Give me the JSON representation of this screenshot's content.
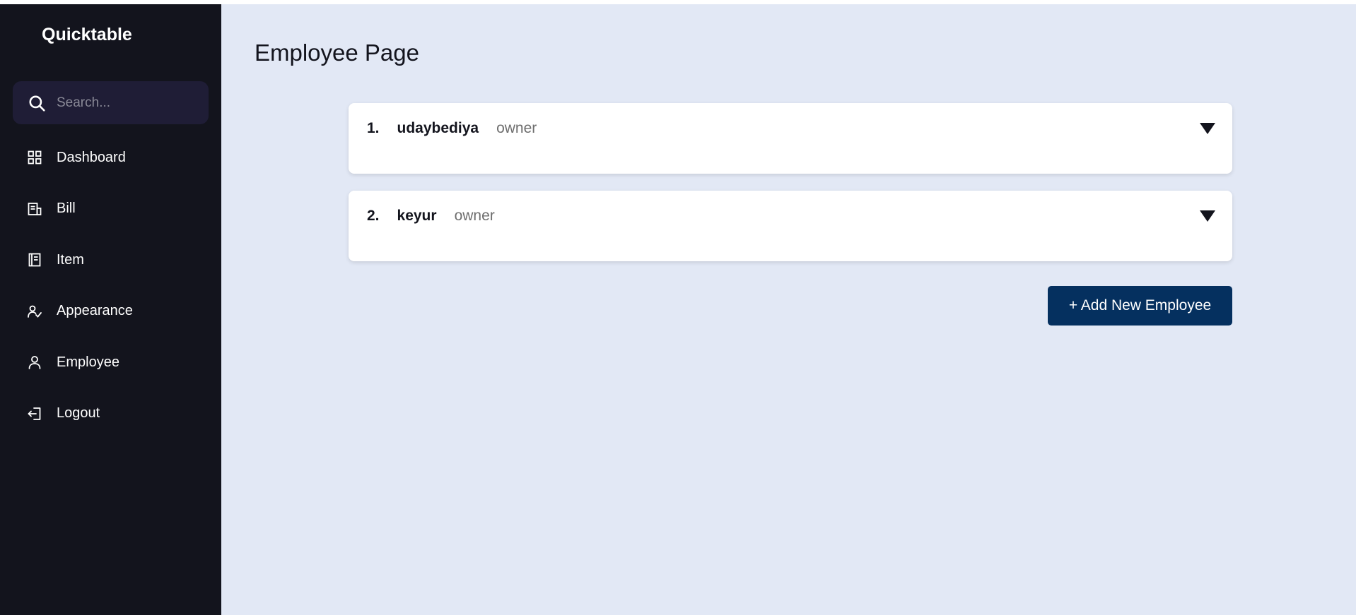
{
  "app": {
    "brand": "Quicktable"
  },
  "search": {
    "placeholder": "Search..."
  },
  "sidebar": {
    "items": [
      {
        "label": "Dashboard",
        "icon": "dashboard-icon"
      },
      {
        "label": "Bill",
        "icon": "bill-icon"
      },
      {
        "label": "Item",
        "icon": "item-icon"
      },
      {
        "label": "Appearance",
        "icon": "appearance-icon"
      },
      {
        "label": "Employee",
        "icon": "employee-icon"
      },
      {
        "label": "Logout",
        "icon": "logout-icon"
      }
    ]
  },
  "main": {
    "title": "Employee Page",
    "employees": [
      {
        "num": "1.",
        "name": "udaybediya",
        "role": "owner"
      },
      {
        "num": "2.",
        "name": "keyur",
        "role": "owner"
      }
    ],
    "add_button_label": "+ Add New Employee"
  },
  "colors": {
    "sidebar_bg": "#13141d",
    "main_bg": "#e2e8f5",
    "primary_button": "#05305f"
  }
}
